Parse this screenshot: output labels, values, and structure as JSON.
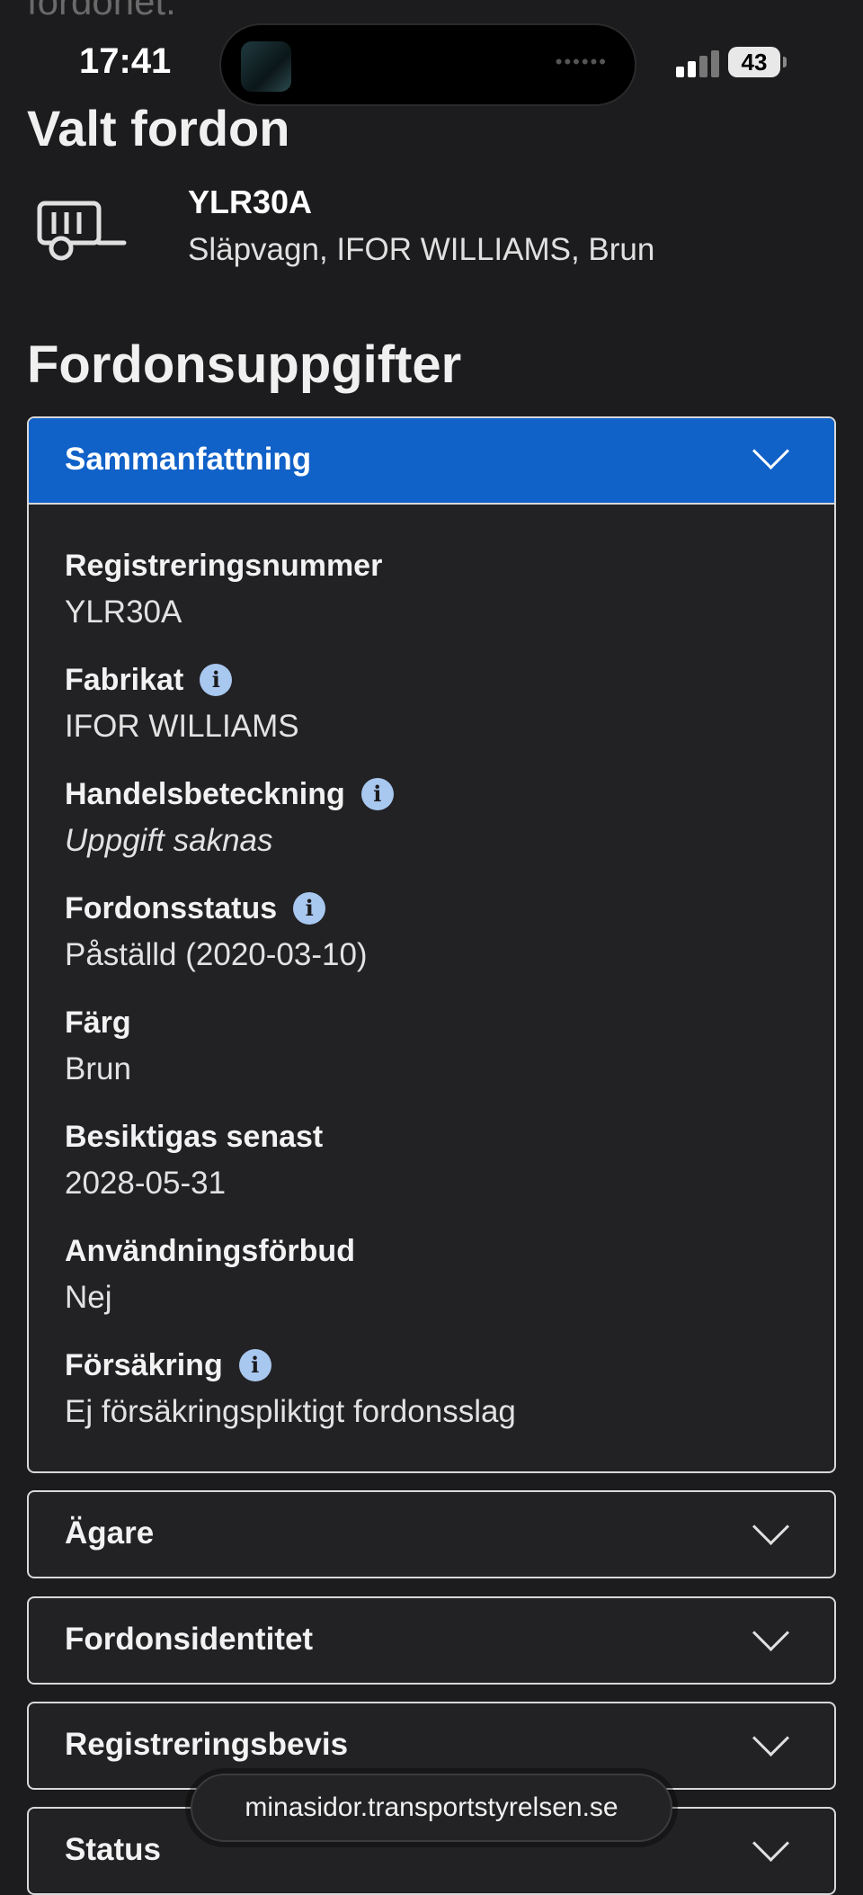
{
  "faded_header_text": "fordonet.",
  "status_bar": {
    "time": "17:41",
    "battery": "43"
  },
  "selected_vehicle": {
    "heading": "Valt fordon",
    "registration": "YLR30A",
    "description": "Släpvagn, IFOR WILLIAMS, Brun",
    "icon": "trailer-icon"
  },
  "details_heading": "Fordonsuppgifter",
  "summary": {
    "title": "Sammanfattning",
    "accent_color": "#1061c8",
    "fields": [
      {
        "label": "Registreringsnummer",
        "value": "YLR30A",
        "info": false
      },
      {
        "label": "Fabrikat",
        "value": "IFOR WILLIAMS",
        "info": true
      },
      {
        "label": "Handelsbeteckning",
        "value": "Uppgift saknas",
        "info": true
      },
      {
        "label": "Fordonsstatus",
        "value": "Påställd (2020-03-10)",
        "info": true
      },
      {
        "label": "Färg",
        "value": "Brun",
        "info": false
      },
      {
        "label": "Besiktigas senast",
        "value": "2028-05-31",
        "info": false
      },
      {
        "label": "Användningsförbud",
        "value": "Nej",
        "info": false
      },
      {
        "label": "Försäkring",
        "value": "Ej försäkringspliktigt fordonsslag",
        "info": true
      }
    ]
  },
  "sections": [
    {
      "label": "Ägare"
    },
    {
      "label": "Fordonsidentitet"
    },
    {
      "label": "Registreringsbevis"
    },
    {
      "label": "Status"
    }
  ],
  "info_icon_glyph": "i",
  "url_bar": "minasidor.transportstyrelsen.se"
}
